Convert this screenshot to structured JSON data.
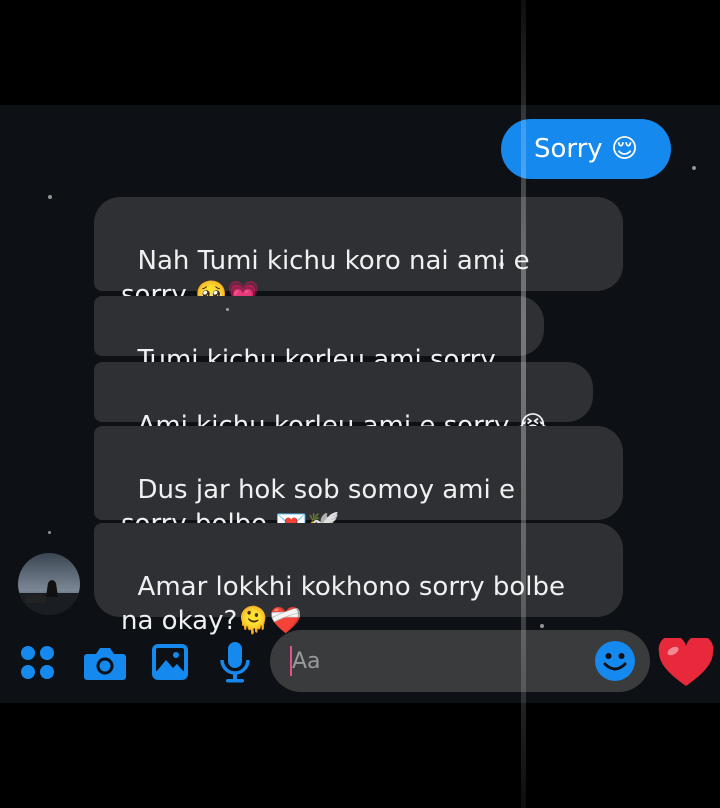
{
  "messages": [
    {
      "side": "out",
      "text": "Sorry 😌"
    },
    {
      "side": "in",
      "text": "Nah Tumi kichu koro nai ami e\nsorry 🥺💗"
    },
    {
      "side": "in",
      "text": "Tumi kichu korleu ami sorry"
    },
    {
      "side": "in",
      "text": "Ami kichu korleu ami e sorry 😭"
    },
    {
      "side": "in",
      "text": "Dus jar hok sob somoy ami e\nsorry bolbo 💌🕊️"
    },
    {
      "side": "in",
      "text": "Amar lokkhi kokhono sorry bolbe\nna okay?🫠❤️‍🩹"
    }
  ],
  "composer": {
    "placeholder": "Aa"
  },
  "icons": {
    "menu": "four-dots-icon",
    "camera": "camera-icon",
    "gallery": "image-icon",
    "voice": "microphone-icon",
    "emoji": "smiley-icon",
    "like": "heart-icon"
  },
  "colors": {
    "accent": "#1589ee",
    "incoming_bubble": "#2f3033",
    "background": "#0d1014",
    "heart": "#e8283b"
  }
}
